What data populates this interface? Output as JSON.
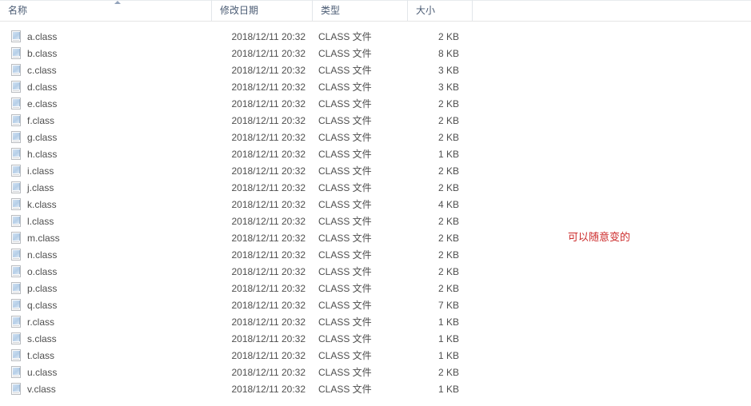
{
  "window": {
    "type": "file-explorer-list-view"
  },
  "columns": {
    "name": "名称",
    "date_modified": "修改日期",
    "type": "类型",
    "size": "大小",
    "sort": {
      "column": "名称",
      "direction": "ascending",
      "icon": "sort-ascending-icon"
    }
  },
  "files": [
    {
      "name": "a.class",
      "date": "2018/12/11 20:32",
      "type": "CLASS 文件",
      "size": "2 KB",
      "icon": "class-file-icon"
    },
    {
      "name": "b.class",
      "date": "2018/12/11 20:32",
      "type": "CLASS 文件",
      "size": "8 KB",
      "icon": "class-file-icon"
    },
    {
      "name": "c.class",
      "date": "2018/12/11 20:32",
      "type": "CLASS 文件",
      "size": "3 KB",
      "icon": "class-file-icon"
    },
    {
      "name": "d.class",
      "date": "2018/12/11 20:32",
      "type": "CLASS 文件",
      "size": "3 KB",
      "icon": "class-file-icon"
    },
    {
      "name": "e.class",
      "date": "2018/12/11 20:32",
      "type": "CLASS 文件",
      "size": "2 KB",
      "icon": "class-file-icon"
    },
    {
      "name": "f.class",
      "date": "2018/12/11 20:32",
      "type": "CLASS 文件",
      "size": "2 KB",
      "icon": "class-file-icon"
    },
    {
      "name": "g.class",
      "date": "2018/12/11 20:32",
      "type": "CLASS 文件",
      "size": "2 KB",
      "icon": "class-file-icon"
    },
    {
      "name": "h.class",
      "date": "2018/12/11 20:32",
      "type": "CLASS 文件",
      "size": "1 KB",
      "icon": "class-file-icon"
    },
    {
      "name": "i.class",
      "date": "2018/12/11 20:32",
      "type": "CLASS 文件",
      "size": "2 KB",
      "icon": "class-file-icon"
    },
    {
      "name": "j.class",
      "date": "2018/12/11 20:32",
      "type": "CLASS 文件",
      "size": "2 KB",
      "icon": "class-file-icon"
    },
    {
      "name": "k.class",
      "date": "2018/12/11 20:32",
      "type": "CLASS 文件",
      "size": "4 KB",
      "icon": "class-file-icon"
    },
    {
      "name": "l.class",
      "date": "2018/12/11 20:32",
      "type": "CLASS 文件",
      "size": "2 KB",
      "icon": "class-file-icon"
    },
    {
      "name": "m.class",
      "date": "2018/12/11 20:32",
      "type": "CLASS 文件",
      "size": "2 KB",
      "icon": "class-file-icon"
    },
    {
      "name": "n.class",
      "date": "2018/12/11 20:32",
      "type": "CLASS 文件",
      "size": "2 KB",
      "icon": "class-file-icon"
    },
    {
      "name": "o.class",
      "date": "2018/12/11 20:32",
      "type": "CLASS 文件",
      "size": "2 KB",
      "icon": "class-file-icon"
    },
    {
      "name": "p.class",
      "date": "2018/12/11 20:32",
      "type": "CLASS 文件",
      "size": "2 KB",
      "icon": "class-file-icon"
    },
    {
      "name": "q.class",
      "date": "2018/12/11 20:32",
      "type": "CLASS 文件",
      "size": "7 KB",
      "icon": "class-file-icon"
    },
    {
      "name": "r.class",
      "date": "2018/12/11 20:32",
      "type": "CLASS 文件",
      "size": "1 KB",
      "icon": "class-file-icon"
    },
    {
      "name": "s.class",
      "date": "2018/12/11 20:32",
      "type": "CLASS 文件",
      "size": "1 KB",
      "icon": "class-file-icon"
    },
    {
      "name": "t.class",
      "date": "2018/12/11 20:32",
      "type": "CLASS 文件",
      "size": "1 KB",
      "icon": "class-file-icon"
    },
    {
      "name": "u.class",
      "date": "2018/12/11 20:32",
      "type": "CLASS 文件",
      "size": "2 KB",
      "icon": "class-file-icon"
    },
    {
      "name": "v.class",
      "date": "2018/12/11 20:32",
      "type": "CLASS 文件",
      "size": "1 KB",
      "icon": "class-file-icon"
    }
  ],
  "annotation": {
    "text": "可以随意变的",
    "color": "#cc2b2b"
  }
}
